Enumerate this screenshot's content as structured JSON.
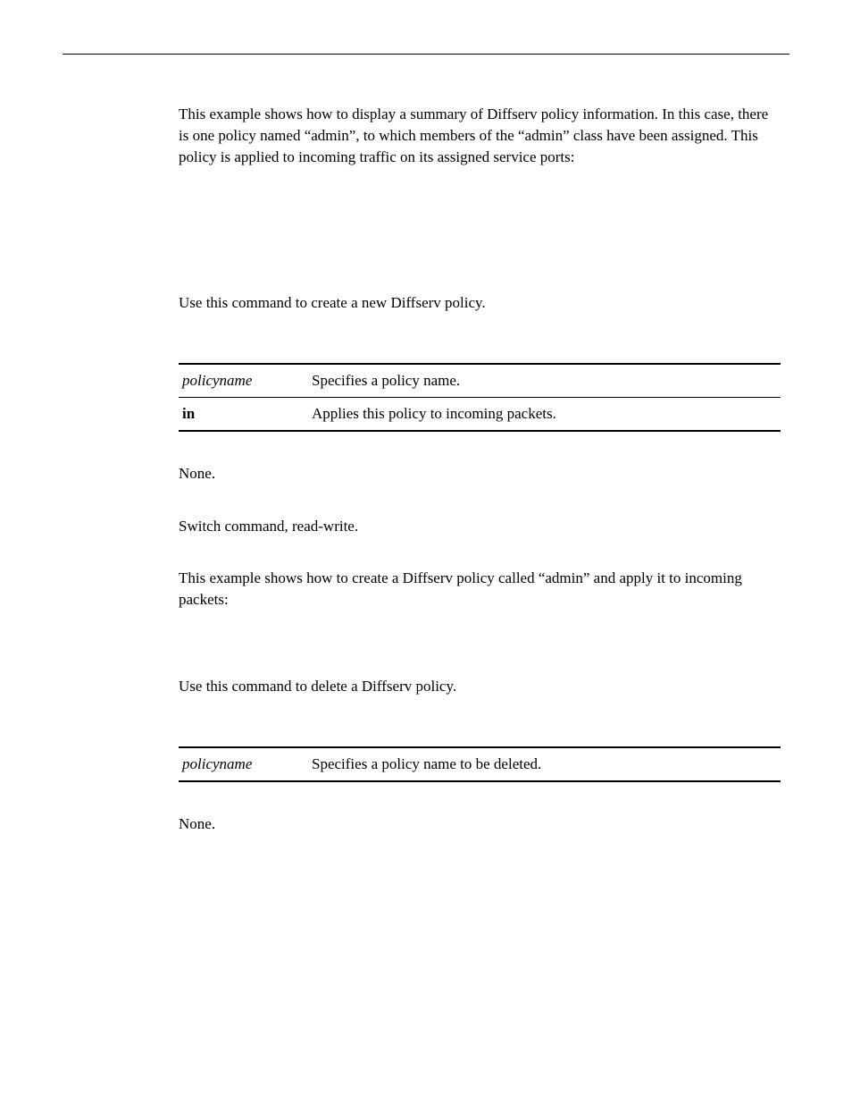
{
  "intro": {
    "example_text": "This example shows how to display a summary of Diffserv policy information. In this case, there is one policy named “admin”, to which members of the “admin” class have been assigned. This policy is applied to incoming traffic on its assigned service ports:"
  },
  "create": {
    "description": "Use this command to create a new Diffserv policy.",
    "params": [
      {
        "name": "policyname",
        "desc": "Specifies a policy name.",
        "italic": true
      },
      {
        "name": "in",
        "desc": "Applies this policy to incoming packets.",
        "italic": false
      }
    ],
    "defaults": "None.",
    "mode": "Switch command, read-write.",
    "example": "This example shows how to create a Diffserv policy called “admin” and apply it to incoming packets:"
  },
  "delete": {
    "description": "Use this command to delete a Diffserv policy.",
    "params": [
      {
        "name": "policyname",
        "desc": "Specifies a policy name to be deleted.",
        "italic": true
      }
    ],
    "defaults": "None."
  }
}
